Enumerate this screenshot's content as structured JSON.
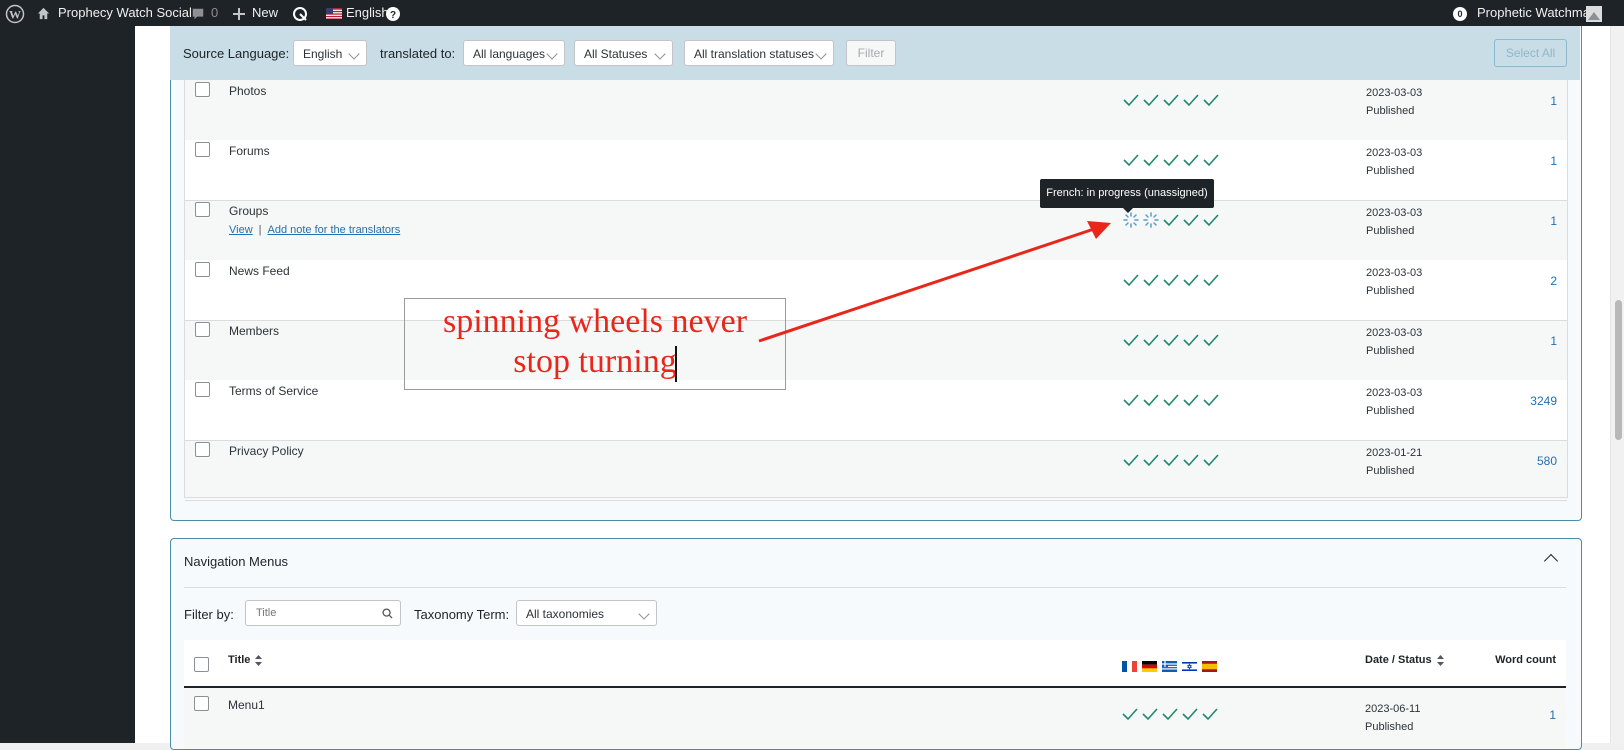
{
  "adminbar": {
    "site_name": "Prophecy Watch Social",
    "comments_count": "0",
    "new_label": "New",
    "language_label": "English",
    "notif_count": "0",
    "user_name": "Prophetic Watchman"
  },
  "filters": {
    "source_language_label": "Source Language:",
    "source_language_value": "English",
    "translated_to_label": "translated to:",
    "translated_to_value": "All languages",
    "status_value": "All Statuses",
    "translation_status_value": "All translation statuses",
    "filter_button": "Filter",
    "select_all_button": "Select All"
  },
  "rows": [
    {
      "title": "Photos",
      "date": "2023-03-03",
      "status": "Published",
      "word_count": "1"
    },
    {
      "title": "Forums",
      "date": "2023-03-03",
      "status": "Published",
      "word_count": "1"
    },
    {
      "title": "Groups",
      "date": "2023-03-03",
      "status": "Published",
      "word_count": "1",
      "action_view": "View",
      "action_note": "Add note for the translators"
    },
    {
      "title": "News Feed",
      "date": "2023-03-03",
      "status": "Published",
      "word_count": "2"
    },
    {
      "title": "Members",
      "date": "2023-03-03",
      "status": "Published",
      "word_count": "1"
    },
    {
      "title": "Terms of Service",
      "date": "2023-03-03",
      "status": "Published",
      "word_count": "3249"
    },
    {
      "title": "Privacy Policy",
      "date": "2023-01-21",
      "status": "Published",
      "word_count": "580"
    }
  ],
  "tooltip": "French: in progress (unassigned)",
  "annotation": {
    "line1": "spinning wheels never",
    "line2": "stop turning"
  },
  "nav_menus": {
    "title": "Navigation Menus",
    "filter_by_label": "Filter by:",
    "title_placeholder": "Title",
    "taxonomy_label": "Taxonomy Term:",
    "taxonomy_value": "All taxonomies",
    "col_title": "Title",
    "col_date_status": "Date / Status",
    "col_word_count": "Word count",
    "flags": [
      "fr-flag",
      "de-flag",
      "gr-flag",
      "il-flag",
      "es-flag"
    ],
    "row": {
      "title": "Menu1",
      "date": "2023-06-11",
      "status": "Published",
      "word_count": "1"
    }
  },
  "colors": {
    "accent": "#2271b1",
    "check_green": "#1e8a6a",
    "annotation_red": "#e8261a"
  }
}
